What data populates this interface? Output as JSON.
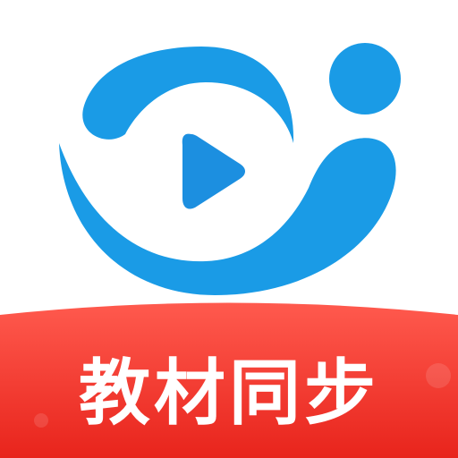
{
  "app_icon": {
    "banner_text": "教材同步",
    "colors": {
      "logo_blue": "#1a9be6",
      "play_blue": "#1c8fe0",
      "banner_red_top": "#ff5a4e",
      "banner_red_bottom": "#e8241c",
      "banner_text": "#ffffff",
      "background": "#ffffff"
    },
    "icons": [
      "play-icon",
      "swirl-logo",
      "head-dot"
    ]
  }
}
